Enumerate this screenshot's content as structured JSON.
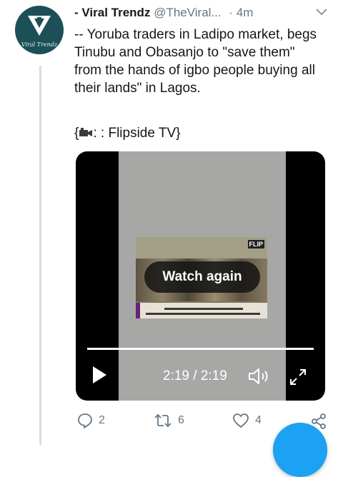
{
  "tweet": {
    "avatar_text": "Viral Trendz",
    "display_name": "- Viral Trendz",
    "handle": "@TheViral...",
    "separator": "·",
    "time": "4m",
    "text": "-- Yoruba traders in Ladipo market, begs Tinubu and Obasanjo to \"save them\" from the hands of igbo people buying all their lands\" in Lagos.",
    "source_prefix": "{",
    "source_suffix": ": : Flipside TV}"
  },
  "video": {
    "overlay_label": "Watch again",
    "time_display": "2:19 / 2:19",
    "progress": 1.0,
    "thumbnail_logo": "FLIP"
  },
  "actions": {
    "reply_count": "2",
    "retweet_count": "6",
    "like_count": "4"
  },
  "icons": {
    "reply": "reply-icon",
    "retweet": "retweet-icon",
    "like": "heart-icon",
    "share": "share-icon",
    "play": "play-icon",
    "volume": "volume-icon",
    "fullscreen": "fullscreen-icon",
    "more": "chevron-down-icon"
  },
  "colors": {
    "accent": "#1da1f2",
    "muted": "#657786",
    "avatar_bg": "#1d4f57"
  }
}
